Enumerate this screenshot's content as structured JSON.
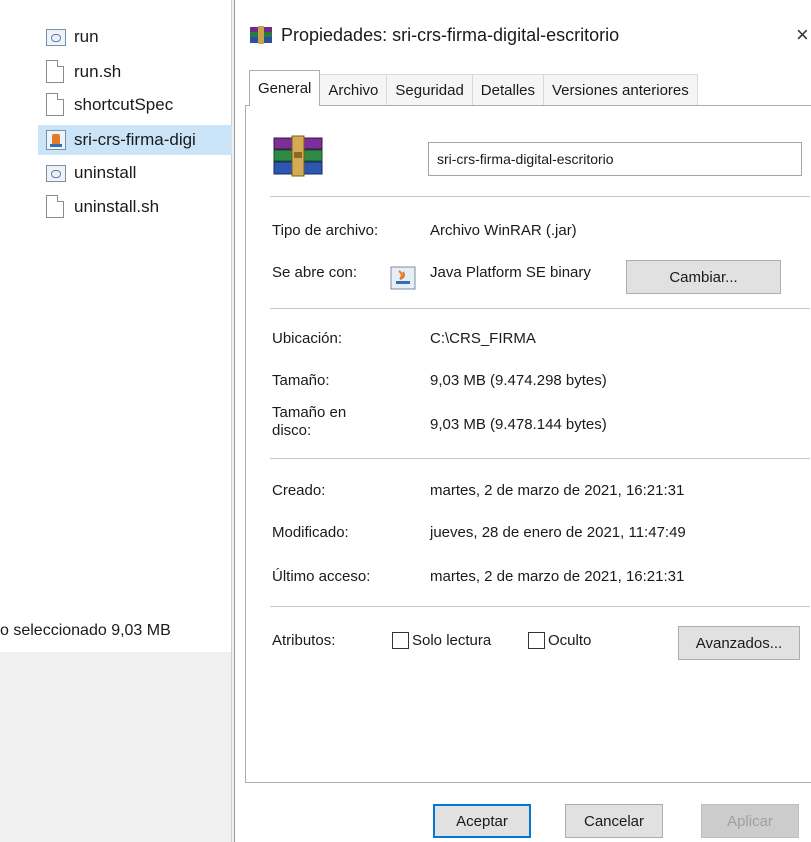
{
  "explorer": {
    "files": [
      {
        "name": "run",
        "icon": "exe-icon"
      },
      {
        "name": "run.sh",
        "icon": "file-icon"
      },
      {
        "name": "shortcutSpec",
        "icon": "file-icon"
      },
      {
        "name": "sri-crs-firma-digi",
        "icon": "java-jar-icon",
        "selected": true
      },
      {
        "name": "uninstall",
        "icon": "exe-icon"
      },
      {
        "name": "uninstall.sh",
        "icon": "file-icon"
      }
    ],
    "status": "o seleccionado  9,03 MB"
  },
  "dialog": {
    "title": "Propiedades: sri-crs-firma-digital-escritorio",
    "close_glyph": "×",
    "tabs": [
      "General",
      "Archivo",
      "Seguridad",
      "Detalles",
      "Versiones anteriores"
    ],
    "active_tab": "General",
    "general": {
      "file_name": "sri-crs-firma-digital-escritorio",
      "file_type_label": "Tipo de archivo:",
      "file_type_value": "Archivo WinRAR (.jar)",
      "opens_with_label": "Se abre con:",
      "opens_with_value": "Java Platform SE binary",
      "change_button": "Cambiar...",
      "location_label": "Ubicación:",
      "location_value": "C:\\CRS_FIRMA",
      "size_label": "Tamaño:",
      "size_value": "9,03 MB (9.474.298 bytes)",
      "size_on_disk_label_1": "Tamaño en",
      "size_on_disk_label_2": "disco:",
      "size_on_disk_value": "9,03 MB (9.478.144 bytes)",
      "created_label": "Creado:",
      "created_value": "martes, 2 de marzo de 2021, 16:21:31",
      "modified_label": "Modificado:",
      "modified_value": "jueves, 28 de enero de 2021, 11:47:49",
      "accessed_label": "Último acceso:",
      "accessed_value": "martes, 2 de marzo de 2021, 16:21:31",
      "attributes_label": "Atributos:",
      "readonly_label": "Solo lectura",
      "hidden_label": "Oculto",
      "advanced_button": "Avanzados..."
    },
    "footer": {
      "ok": "Aceptar",
      "cancel": "Cancelar",
      "apply": "Aplicar"
    }
  }
}
